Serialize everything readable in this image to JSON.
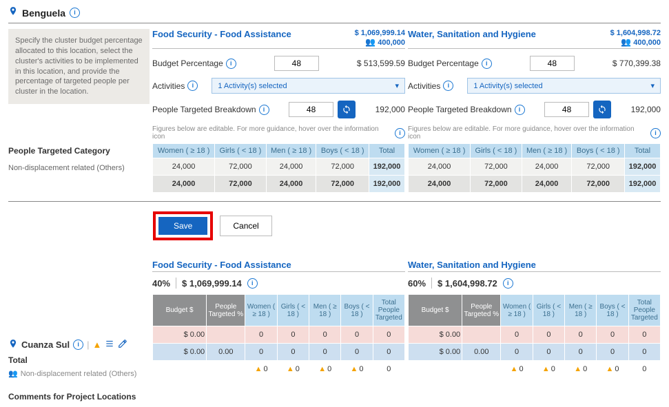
{
  "location1": {
    "name": "Benguela"
  },
  "helpText": "Specify the cluster budget percentage allocated to this location, select the cluster's activities to be implemented in this location, and provide the percentage of targeted people per cluster in the location.",
  "leftBreakdown": {
    "title": "People Targeted Category",
    "row": "Non-displacement related (Others)"
  },
  "clusters": [
    {
      "title": "Food Security - Food Assistance",
      "totalBudget": "$ 1,069,999.14",
      "totalPeople": "400,000",
      "budgetPctLabel": "Budget Percentage",
      "budgetPct": "48",
      "allocBudget": "$ 513,599.59",
      "activitiesLabel": "Activities",
      "activitiesSel": "1 Activity(s) selected",
      "ptbLabel": "People Targeted Breakdown",
      "ptbPct": "48",
      "ptbValue": "192,000",
      "hint": "Figures below are editable. For more guidance, hover over the information icon",
      "cols": {
        "w": "Women\n( ≥ 18 )",
        "g": "Girls\n( < 18 )",
        "m": "Men\n( ≥ 18 )",
        "b": "Boys\n( < 18 )",
        "t": "Total"
      },
      "row1": {
        "w": "24,000",
        "g": "72,000",
        "m": "24,000",
        "b": "72,000",
        "t": "192,000"
      },
      "row2": {
        "w": "24,000",
        "g": "72,000",
        "m": "24,000",
        "b": "72,000",
        "t": "192,000"
      }
    },
    {
      "title": "Water, Sanitation and Hygiene",
      "totalBudget": "$ 1,604,998.72",
      "totalPeople": "400,000",
      "budgetPctLabel": "Budget Percentage",
      "budgetPct": "48",
      "allocBudget": "$ 770,399.38",
      "activitiesLabel": "Activities",
      "activitiesSel": "1 Activity(s) selected",
      "ptbLabel": "People Targeted Breakdown",
      "ptbPct": "48",
      "ptbValue": "192,000",
      "hint": "Figures below are editable. For more guidance, hover over the information icon",
      "cols": {
        "w": "Women\n( ≥ 18 )",
        "g": "Girls\n( < 18 )",
        "m": "Men\n( ≥ 18 )",
        "b": "Boys\n( < 18 )",
        "t": "Total"
      },
      "row1": {
        "w": "24,000",
        "g": "72,000",
        "m": "24,000",
        "b": "72,000",
        "t": "192,000"
      },
      "row2": {
        "w": "24,000",
        "g": "72,000",
        "m": "24,000",
        "b": "72,000",
        "t": "192,000"
      }
    }
  ],
  "buttons": {
    "save": "Save",
    "cancel": "Cancel"
  },
  "location2": {
    "name": "Cuanza Sul",
    "total": "Total",
    "row": "Non-displacement related (Others)"
  },
  "clusters2": [
    {
      "title": "Food Security - Food Assistance",
      "pct": "40%",
      "amount": "$ 1,069,999.14",
      "cols": {
        "budget": "Budget $",
        "pt": "People\nTargeted\n%",
        "w": "Women\n( ≥ 18 )",
        "g": "Girls\n( < 18 )",
        "m": "Men\n( ≥ 18 )",
        "b": "Boys\n( < 18 )",
        "t": "Total\nPeople\nTargeted"
      },
      "row1": {
        "budget": "$ 0.00",
        "pt": "",
        "w": "0",
        "g": "0",
        "m": "0",
        "b": "0",
        "t": "0"
      },
      "row2": {
        "budget": "$ 0.00",
        "pt": "0.00",
        "w": "0",
        "g": "0",
        "m": "0",
        "b": "0",
        "t": "0"
      },
      "row3": {
        "w": "0",
        "g": "0",
        "m": "0",
        "b": "0",
        "t": "0"
      }
    },
    {
      "title": "Water, Sanitation and Hygiene",
      "pct": "60%",
      "amount": "$ 1,604,998.72",
      "cols": {
        "budget": "Budget $",
        "pt": "People\nTargeted\n%",
        "w": "Women\n( ≥ 18 )",
        "g": "Girls\n( < 18 )",
        "m": "Men\n( ≥ 18 )",
        "b": "Boys\n( < 18 )",
        "t": "Total\nPeople\nTargeted"
      },
      "row1": {
        "budget": "$ 0.00",
        "pt": "",
        "w": "0",
        "g": "0",
        "m": "0",
        "b": "0",
        "t": "0"
      },
      "row2": {
        "budget": "$ 0.00",
        "pt": "0.00",
        "w": "0",
        "g": "0",
        "m": "0",
        "b": "0",
        "t": "0"
      },
      "row3": {
        "w": "0",
        "g": "0",
        "m": "0",
        "b": "0",
        "t": "0"
      }
    }
  ],
  "footerLabel": "Comments for Project Locations"
}
